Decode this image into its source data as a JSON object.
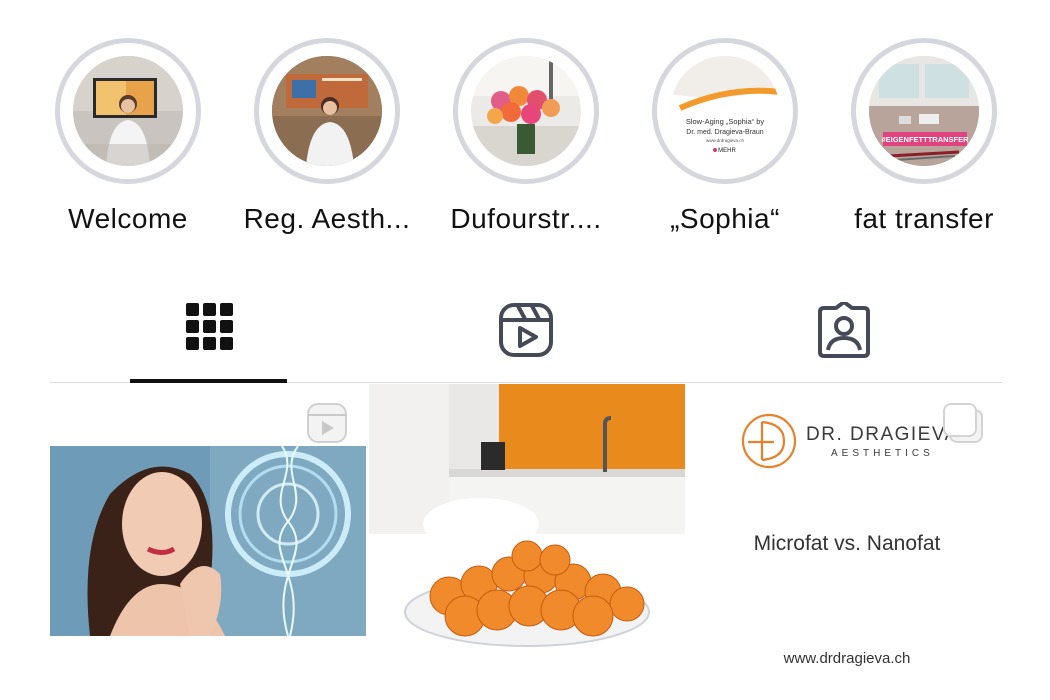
{
  "highlights": [
    {
      "label": "Welcome",
      "icon": "highlight-cover-welcome"
    },
    {
      "label": "Reg. Aesth...",
      "icon": "highlight-cover-reg-aesth"
    },
    {
      "label": "Dufourstr....",
      "icon": "highlight-cover-roses"
    },
    {
      "label": "„Sophia“",
      "icon": "highlight-cover-sophia",
      "cover_text": {
        "line1": "Slow-Aging „Sophia“ by",
        "line2": "Dr. med. Dragieva-Braun",
        "line3": "www.drdragieva.ch",
        "more": "MEHR"
      }
    },
    {
      "label": "fat transfer",
      "icon": "highlight-cover-fat-transfer",
      "cover_text": {
        "tag": "#EIGENFETTTRANSFER"
      }
    }
  ],
  "tabs": [
    {
      "name": "posts",
      "icon": "grid-icon",
      "active": true
    },
    {
      "name": "reels",
      "icon": "reels-icon",
      "active": false
    },
    {
      "name": "tagged",
      "icon": "tagged-icon",
      "active": false
    }
  ],
  "posts": [
    {
      "type": "reel",
      "badge_icon": "reel-badge-icon",
      "image": "woman-dna-image"
    },
    {
      "type": "photo",
      "image": "apricots-bowl-image"
    },
    {
      "type": "carousel",
      "badge_icon": "carousel-badge-icon",
      "logo_name": "DR. DRAGIEVA",
      "logo_sub": "AESTHETICS",
      "title": "Microfat vs. Nanofat",
      "url": "www.drdragieva.ch"
    }
  ],
  "colors": {
    "ring": "#d5d6de",
    "active_tab": "#111111",
    "brand_orange": "#e8812a",
    "divider": "#dbdbdb"
  }
}
